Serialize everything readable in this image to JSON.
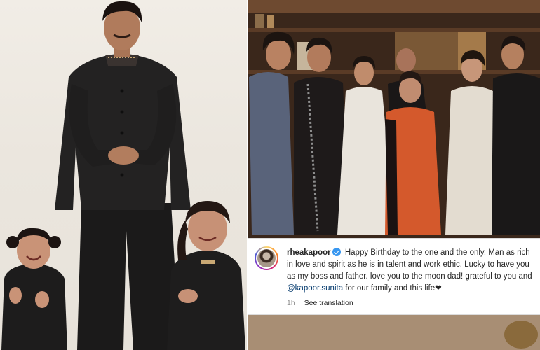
{
  "post": {
    "username": "rheakapoor",
    "caption_before_mention": "Happy Birthday to the one and the only. Man as rich in love and spirit as he is in talent and work ethic. Lucky to have you as my boss and father. love you to the moon dad! grateful to you and ",
    "mention": "@kapoor.sunita",
    "caption_after_mention": " for our family and this life❤",
    "timestamp": "1h",
    "see_translation": "See translation"
  },
  "icons": {
    "verified": "verified-badge-icon",
    "avatar": "profile-avatar"
  },
  "colors": {
    "verified_blue": "#3897f0",
    "mention_blue": "#00376b",
    "meta_gray": "#8e8e8e"
  }
}
